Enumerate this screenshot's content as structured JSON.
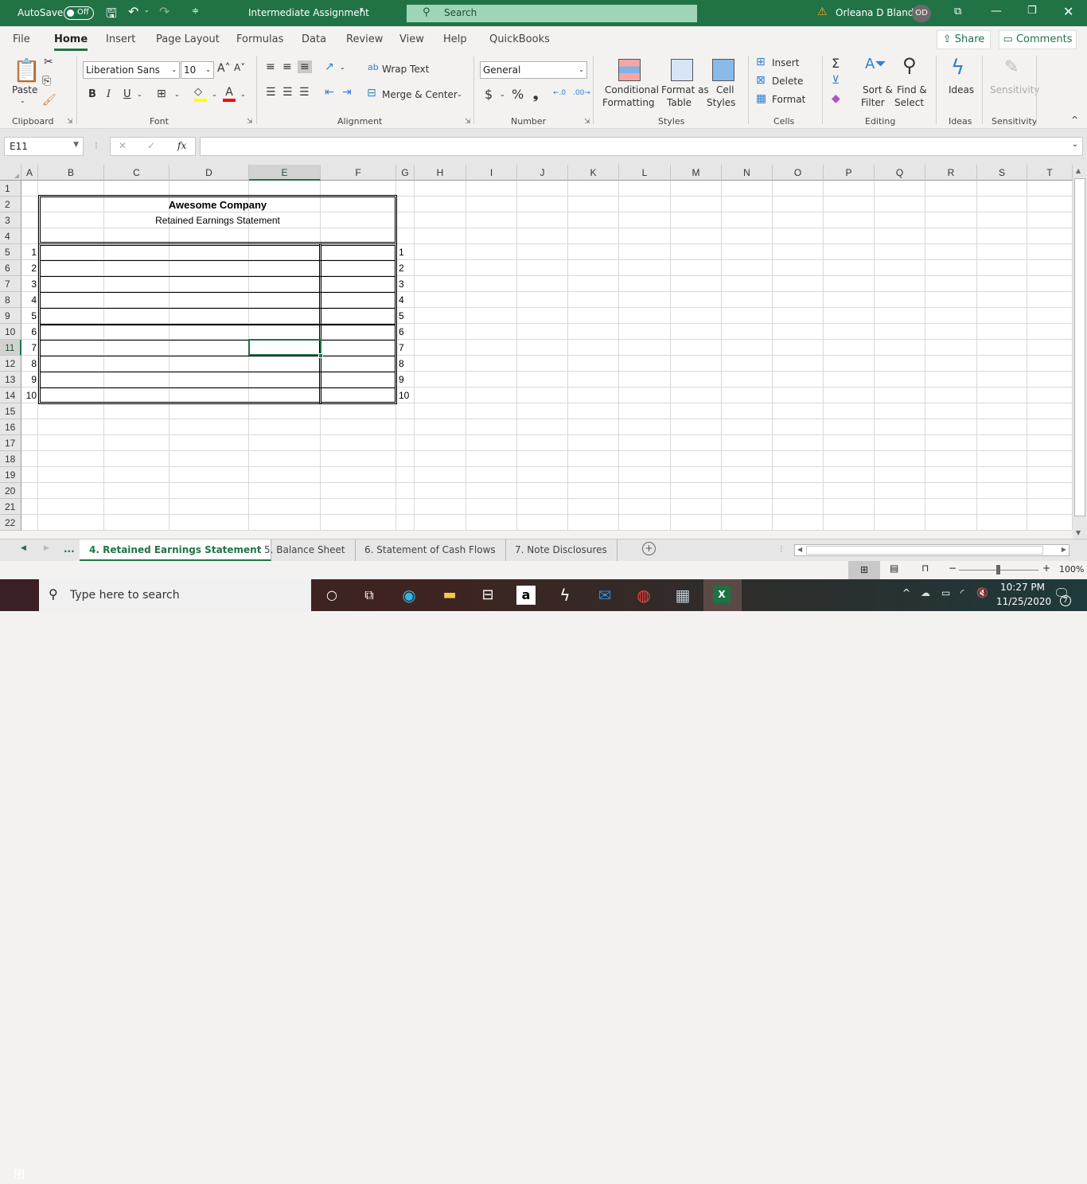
{
  "titlebar": {
    "autosave_label": "AutoSave",
    "autosave_state": "Off",
    "doc_title": "Intermediate Assignment",
    "search_placeholder": "Search",
    "user_name": "Orleana D Bland",
    "user_initials": "OD",
    "warning_icon": "warning-icon",
    "window_controls": [
      "ribbon-display-options",
      "minimize",
      "restore",
      "close"
    ]
  },
  "menu": {
    "tabs": [
      "File",
      "Home",
      "Insert",
      "Page Layout",
      "Formulas",
      "Data",
      "Review",
      "View",
      "Help",
      "QuickBooks"
    ],
    "active": "Home",
    "share_label": "Share",
    "comments_label": "Comments"
  },
  "ribbon": {
    "clipboard": {
      "label": "Clipboard",
      "paste": "Paste"
    },
    "font": {
      "label": "Font",
      "font_name": "Liberation Sans",
      "font_size": "10",
      "bold": "B",
      "italic": "I",
      "underline": "U",
      "highlight_color": "#ffff00",
      "font_color": "#ff0000"
    },
    "alignment": {
      "label": "Alignment",
      "wrap_text": "Wrap Text",
      "merge_center": "Merge & Center"
    },
    "number": {
      "label": "Number",
      "format": "General",
      "currency": "$",
      "percent": "%",
      "comma": "9"
    },
    "styles": {
      "label": "Styles",
      "conditional_1": "Conditional",
      "conditional_2": "Formatting",
      "format_table_1": "Format as",
      "format_table_2": "Table",
      "cell_styles_1": "Cell",
      "cell_styles_2": "Styles"
    },
    "cells": {
      "label": "Cells",
      "insert": "Insert",
      "delete": "Delete",
      "format": "Format"
    },
    "editing": {
      "label": "Editing",
      "sort_1": "Sort &",
      "sort_2": "Filter",
      "find_1": "Find &",
      "find_2": "Select"
    },
    "ideas": {
      "label": "Ideas",
      "button": "Ideas"
    },
    "sensitivity": {
      "label": "Sensitivity",
      "button": "Sensitivity"
    }
  },
  "formula_bar": {
    "name_box": "E11",
    "cancel": "✕",
    "enter": "✓",
    "fx": "fx",
    "formula": ""
  },
  "grid": {
    "columns": [
      "A",
      "B",
      "C",
      "D",
      "E",
      "F",
      "G",
      "H",
      "I",
      "J",
      "K",
      "L",
      "M",
      "N",
      "O",
      "P",
      "Q",
      "R",
      "S",
      "T"
    ],
    "rows": [
      "1",
      "2",
      "3",
      "4",
      "5",
      "6",
      "7",
      "8",
      "9",
      "10",
      "11",
      "12",
      "13",
      "14",
      "15",
      "16",
      "17",
      "18",
      "19",
      "20",
      "21",
      "22"
    ],
    "selected_cell": "E11",
    "title": "Awesome Company",
    "subtitle": "Retained Earnings Statement",
    "line_numbers_a": [
      "1",
      "2",
      "3",
      "4",
      "5",
      "6",
      "7",
      "8",
      "9",
      "10"
    ],
    "line_numbers_g": [
      "1",
      "2",
      "3",
      "4",
      "5",
      "6",
      "7",
      "8",
      "9",
      "10"
    ]
  },
  "sheets": {
    "tabs": [
      "4. Retained Earnings Statement",
      "5. Balance Sheet",
      "6. Statement of Cash Flows",
      "7. Note Disclosures"
    ],
    "active": "4. Retained Earnings Statement",
    "more": "...",
    "add": "+"
  },
  "statusbar": {
    "zoom": "100%",
    "zoom_level_percent": 100
  },
  "taskbar": {
    "search_placeholder": "Type here to search",
    "time": "10:27 PM",
    "date": "11/25/2020",
    "notifications": "7",
    "apps": [
      "cortana",
      "task-view",
      "edge",
      "file-explorer",
      "store",
      "amazon",
      "bolt",
      "mail",
      "chrome",
      "calculator",
      "excel"
    ]
  }
}
